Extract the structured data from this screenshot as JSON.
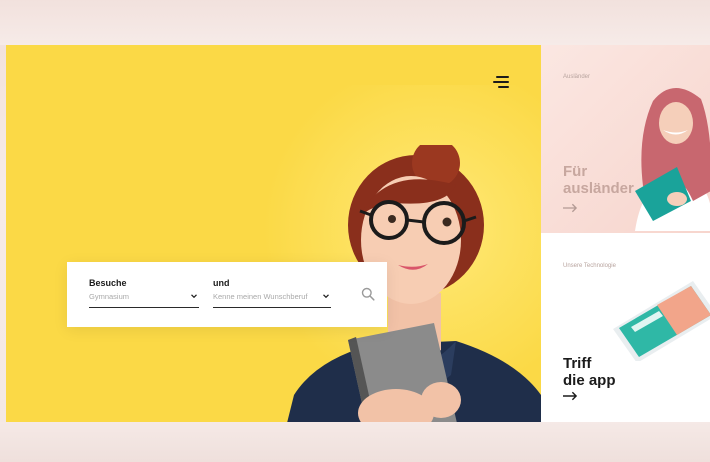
{
  "hero": {
    "menu_icon": "hamburger-menu-icon",
    "background_color": "#fbd946",
    "search": {
      "field1_label": "Besuche",
      "field1_value": "Gymnasium",
      "field2_label": "und",
      "field2_value": "Kenne meinen Wunschberuf",
      "search_icon": "search-icon"
    }
  },
  "cards": {
    "top": {
      "eyebrow": "Ausländer",
      "title_line1": "Für",
      "title_line2": "ausländer",
      "arrow_icon": "arrow-right-icon"
    },
    "bottom": {
      "eyebrow": "Unsere Technologie",
      "title_line1": "Triff",
      "title_line2": "die app",
      "arrow_icon": "arrow-right-icon"
    }
  }
}
